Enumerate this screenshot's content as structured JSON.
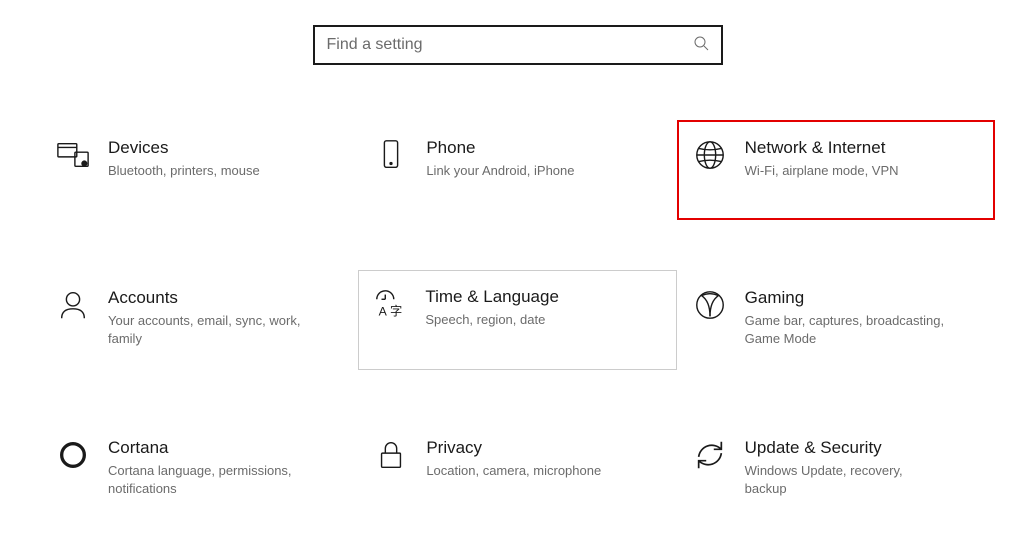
{
  "search": {
    "placeholder": "Find a setting"
  },
  "tiles": {
    "devices": {
      "title": "Devices",
      "desc": "Bluetooth, printers, mouse"
    },
    "phone": {
      "title": "Phone",
      "desc": "Link your Android, iPhone"
    },
    "network": {
      "title": "Network & Internet",
      "desc": "Wi-Fi, airplane mode, VPN"
    },
    "accounts": {
      "title": "Accounts",
      "desc": "Your accounts, email, sync, work, family"
    },
    "time": {
      "title": "Time & Language",
      "desc": "Speech, region, date"
    },
    "gaming": {
      "title": "Gaming",
      "desc": "Game bar, captures, broadcasting, Game Mode"
    },
    "cortana": {
      "title": "Cortana",
      "desc": "Cortana language, permissions, notifications"
    },
    "privacy": {
      "title": "Privacy",
      "desc": "Location, camera, microphone"
    },
    "update": {
      "title": "Update & Security",
      "desc": "Windows Update, recovery, backup"
    }
  }
}
